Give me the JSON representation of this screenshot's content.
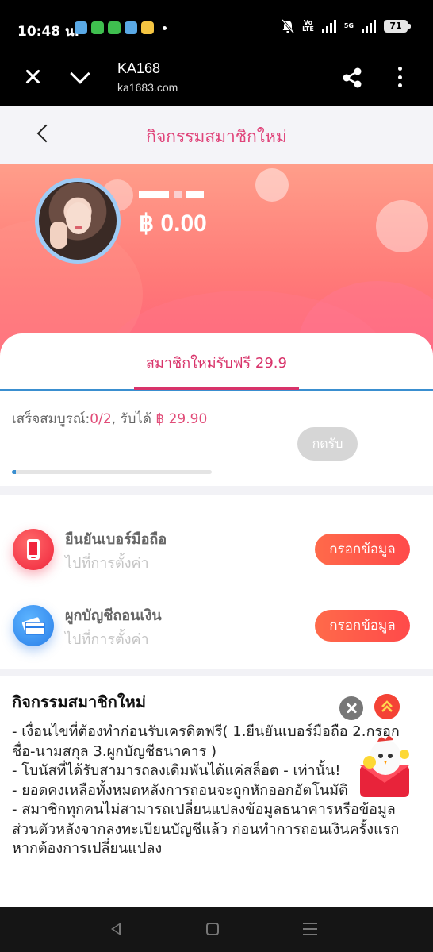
{
  "status_bar": {
    "time": "10:48 น.",
    "volte": "Vo\nLTE",
    "network": "5G",
    "battery": "71"
  },
  "browser": {
    "title": "KA168",
    "url": "ka1683.com"
  },
  "header": {
    "title": "กิจกรรมสมาชิกใหม่"
  },
  "profile": {
    "balance": "฿ 0.00"
  },
  "task_card": {
    "tab_label": "สมาชิกใหม่รับฟรี 29.9",
    "progress_prefix": "เสร็จสมบูรณ์:",
    "progress_count": "0/2",
    "reward_prefix": ", รับได้ ",
    "reward_amount": "฿ 29.90",
    "progress_fraction": 0.02,
    "claim_label": "กดรับ"
  },
  "tasks": [
    {
      "title": "ยืนยันเบอร์มือถือ",
      "subtitle": "ไปที่การตั้งค่า",
      "button": "กรอกข้อมูล",
      "icon": "phone-icon"
    },
    {
      "title": "ผูกบัญชีถอนเงิน",
      "subtitle": "ไปที่การตั้งค่า",
      "button": "กรอกข้อมูล",
      "icon": "bank-card-icon"
    }
  ],
  "rules": {
    "title": "กิจกรรมสมาชิกใหม่",
    "lines": [
      "- เงื่อนไขที่ต้องทำก่อนรับเครดิตฟรี( 1.ยืนยันเบอร์มือถือ 2.กรอกชื่อ-นามสกุล 3.ผูกบัญชีธนาคาร )",
      "- โบนัสที่ได้รับสามารถลงเดิมพันได้แค่สล็อต - เท่านั้น!",
      "- ยอดคงเหลือทั้งหมดหลังการถอนจะถูกหักออกอัตโนมัติ",
      "- สมาชิกทุกคนไม่สามารถเปลี่ยนแปลงข้อมูลธนาคารหรือข้อมูลส่วนตัวหลังจากลงทะเบียนบัญชีแล้ว ก่อนทำการถอนเงินครั้งแรก หากต้องการเปลี่ยนแปลง"
    ]
  },
  "colors": {
    "accent": "#e0447a",
    "button_gradient_start": "#ff6a4a",
    "progress": "#3a8fd0"
  }
}
